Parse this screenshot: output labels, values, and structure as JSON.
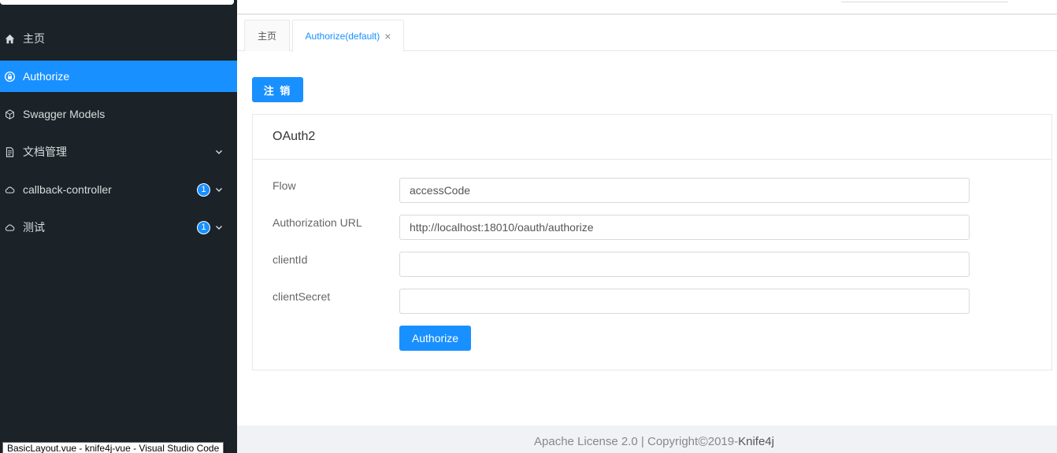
{
  "sidebar": {
    "items": [
      {
        "label": "主页",
        "icon": "home-icon",
        "active": false,
        "badge": null,
        "chevron": false
      },
      {
        "label": "Authorize",
        "icon": "lock-icon",
        "active": true,
        "badge": null,
        "chevron": false
      },
      {
        "label": "Swagger Models",
        "icon": "code-sandbox-icon",
        "active": false,
        "badge": null,
        "chevron": false
      },
      {
        "label": "文档管理",
        "icon": "document-icon",
        "active": false,
        "badge": null,
        "chevron": true
      },
      {
        "label": "callback-controller",
        "icon": "cloud-icon",
        "active": false,
        "badge": "1",
        "chevron": true
      },
      {
        "label": "测试",
        "icon": "cloud-icon",
        "active": false,
        "badge": "1",
        "chevron": true
      }
    ]
  },
  "tabs": [
    {
      "label": "主页",
      "active": false
    },
    {
      "label": "Authorize(default)",
      "active": true,
      "closable": true
    }
  ],
  "logout_label": "注 销",
  "card": {
    "title": "OAuth2",
    "fields": [
      {
        "label": "Flow",
        "value": "accessCode"
      },
      {
        "label": "Authorization URL",
        "value": "http://localhost:18010/oauth/authorize"
      },
      {
        "label": "clientId",
        "value": ""
      },
      {
        "label": "clientSecret",
        "value": ""
      }
    ],
    "authorize_label": "Authorize"
  },
  "footer": {
    "license": "Apache License 2.0 | Copyright ",
    "copyright_symbol": "©",
    "year": " 2019-",
    "brand": "Knife4j"
  },
  "os_tooltip": "BasicLayout.vue - knife4j-vue - Visual Studio Code",
  "colors": {
    "accent": "#1890ff",
    "sidebar_bg": "#1b2328"
  }
}
